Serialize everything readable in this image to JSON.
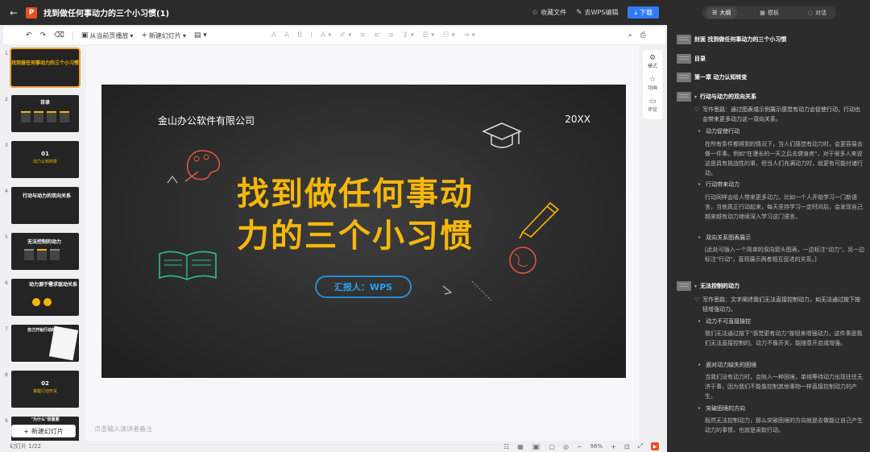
{
  "titlebar": {
    "back": "←",
    "logo": "P",
    "doc_title": "找到做任何事动力的三个小习惯(1)",
    "favorite_file": "收藏文件",
    "edit_in_wps": "去WPS编辑",
    "download": "下载"
  },
  "toolbar": {
    "play_from_current": "从当前页播放",
    "new_slide": "新建幻灯片"
  },
  "thumbnails": [
    {
      "num": "1",
      "title": "找到做任何事动力的三个小习惯"
    },
    {
      "num": "2",
      "title": "目录"
    },
    {
      "num": "3",
      "chapter": "01",
      "subtitle": "动力认知转变"
    },
    {
      "num": "4",
      "title": "行动与动力的双向关系"
    },
    {
      "num": "5",
      "title": "无法控制的动力"
    },
    {
      "num": "6",
      "title": "动力源于需求驱动关系"
    },
    {
      "num": "7",
      "title": "自己开始行动的方式"
    },
    {
      "num": "8",
      "chapter": "02",
      "subtitle": "掌握行动开关"
    },
    {
      "num": "9",
      "title": "\"为什么\"很重要"
    }
  ],
  "add_slide": "新建幻灯片",
  "slide": {
    "company": "金山办公软件有限公司",
    "year": "20XX",
    "title_line1": "找到做任何事动",
    "title_line2": "力的三个小习惯",
    "reporter": "汇报人：WPS"
  },
  "notes_hint": "点击输入演讲者备注",
  "rail": {
    "style": "模式",
    "animation": "动画",
    "comment": "评论"
  },
  "status": {
    "pages": "幻灯片 1/22",
    "zoom": "96%"
  },
  "outline": {
    "tabs": {
      "outline": "大纲",
      "template": "模板",
      "chat": "对话"
    },
    "cover": "封面 找到做任何事动力的三个小习惯",
    "toc": "目录",
    "chapter1": "第一章 动力认知转变",
    "sec1": "行动与动力的双向关系",
    "sec1_think": "写作思路：通过图表或示例展示感觉有动力会促使行动，行动也会带来更多动力这一双向关系。",
    "sec1_b1": "动力促使行动",
    "sec1_b1_body": "在所有条件都得到的情况下，当人们感觉有动力时，会更容易去做一件事。例如\"在漫长的一天之后去健身房\"，对于很多人来说这是具有挑战性的事，但当人们充满动力时，就更有可能付诸行动。",
    "sec1_b2": "行动带来动力",
    "sec1_b2_body": "行动同样会给人带来更多动力。比如一个人开始学习一门新语言，当他真正行动起来，每天坚持学习一定时间后，会发现自己越来越有动力继续深入学习这门语言。",
    "sec1_b3": "双向关系图表展示",
    "sec1_b3_body": "[此处可插入一个简单的双向箭头图表，一边标注\"动力\"，另一边标注\"行动\"，直观展示两者相互促进的关系。]",
    "sec2": "无法控制的动力",
    "sec2_think": "写作思路：文字阐述我们无法直接控制动力，如无法通过按下按钮增强动力。",
    "sec2_b1": "动力不可直接操控",
    "sec2_b1_body": "我们无法通过按下\"感觉更有动力\"按钮来增强动力，这件事是我们无法直接控制的。动力不像开关，能随意开启或增强。",
    "sec2_b2": "面对动力缺失的困境",
    "sec2_b2_body": "当我们没有动力时，会陷入一种困境，单纯等待动力出现往往无济于事，因为我们不能像控制其他事物一样直接控制动力的产生。",
    "sec2_b3": "突破困境的方向",
    "sec2_b3_body": "既然无法控制动力，那么突破困境的方向就是去做能让自己产生动力的事情，也就是采取行动。"
  },
  "colors": {
    "accent_yellow": "#f6b70b",
    "reporter_blue": "#2d9ff0",
    "download_blue": "#2f7cf6",
    "brand_orange": "#e8501d"
  }
}
